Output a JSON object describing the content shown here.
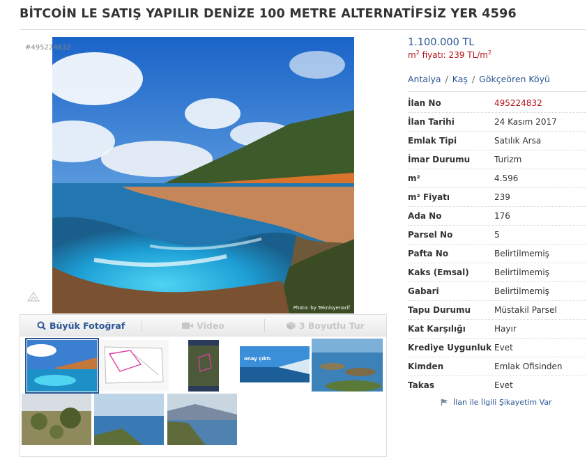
{
  "title": "BİTCOİN LE SATIŞ YAPILIR DENİZE 100 METRE ALTERNATİFSİZ YER 4596",
  "gallery": {
    "id_overlay": "#495224832",
    "photo_credit": "Photo: by Teknisyenarif",
    "toolbar": {
      "big_photo": "Büyük Fotoğraf",
      "video": "Video",
      "tour_3d": "3 Boyutlu Tur"
    },
    "thumbnails": [
      "coast-cliff-photo",
      "parcel-map",
      "aerial-map",
      "announcement-banner",
      "islands-aerial",
      "olive-trees",
      "sea-view",
      "hillside-sea"
    ],
    "thumb_banner_text": "onay çıktı"
  },
  "price": "1.100.000 TL",
  "sqm_price": {
    "prefix": "m",
    "sup": "2",
    "text": " fiyatı: 239 TL/m",
    "sup2": "2"
  },
  "breadcrumb": [
    "Antalya",
    "Kaş",
    "Gökçeören Köyü"
  ],
  "info_rows": [
    {
      "key": "İlan No",
      "value": "495224832"
    },
    {
      "key": "İlan Tarihi",
      "value": "24 Kasım 2017"
    },
    {
      "key": "Emlak Tipi",
      "value": "Satılık Arsa"
    },
    {
      "key": "İmar Durumu",
      "value": "Turizm"
    },
    {
      "key": "m²",
      "value": "4.596"
    },
    {
      "key": "m² Fiyatı",
      "value": "239"
    },
    {
      "key": "Ada No",
      "value": "176"
    },
    {
      "key": "Parsel No",
      "value": "5"
    },
    {
      "key": "Pafta No",
      "value": "Belirtilmemiş"
    },
    {
      "key": "Kaks (Emsal)",
      "value": "Belirtilmemiş"
    },
    {
      "key": "Gabari",
      "value": "Belirtilmemiş"
    },
    {
      "key": "Tapu Durumu",
      "value": "Müstakil Parsel"
    },
    {
      "key": "Kat Karşılığı",
      "value": "Hayır"
    },
    {
      "key": "Krediye Uygunluk",
      "value": "Evet"
    },
    {
      "key": "Kimden",
      "value": "Emlak Ofisinden"
    },
    {
      "key": "Takas",
      "value": "Evet"
    }
  ],
  "report_link": "İlan ile İlgili Şikayetim Var",
  "colors": {
    "link_blue": "#2a5694",
    "price_red": "#b5121b",
    "sea": "#1fa3d8"
  }
}
